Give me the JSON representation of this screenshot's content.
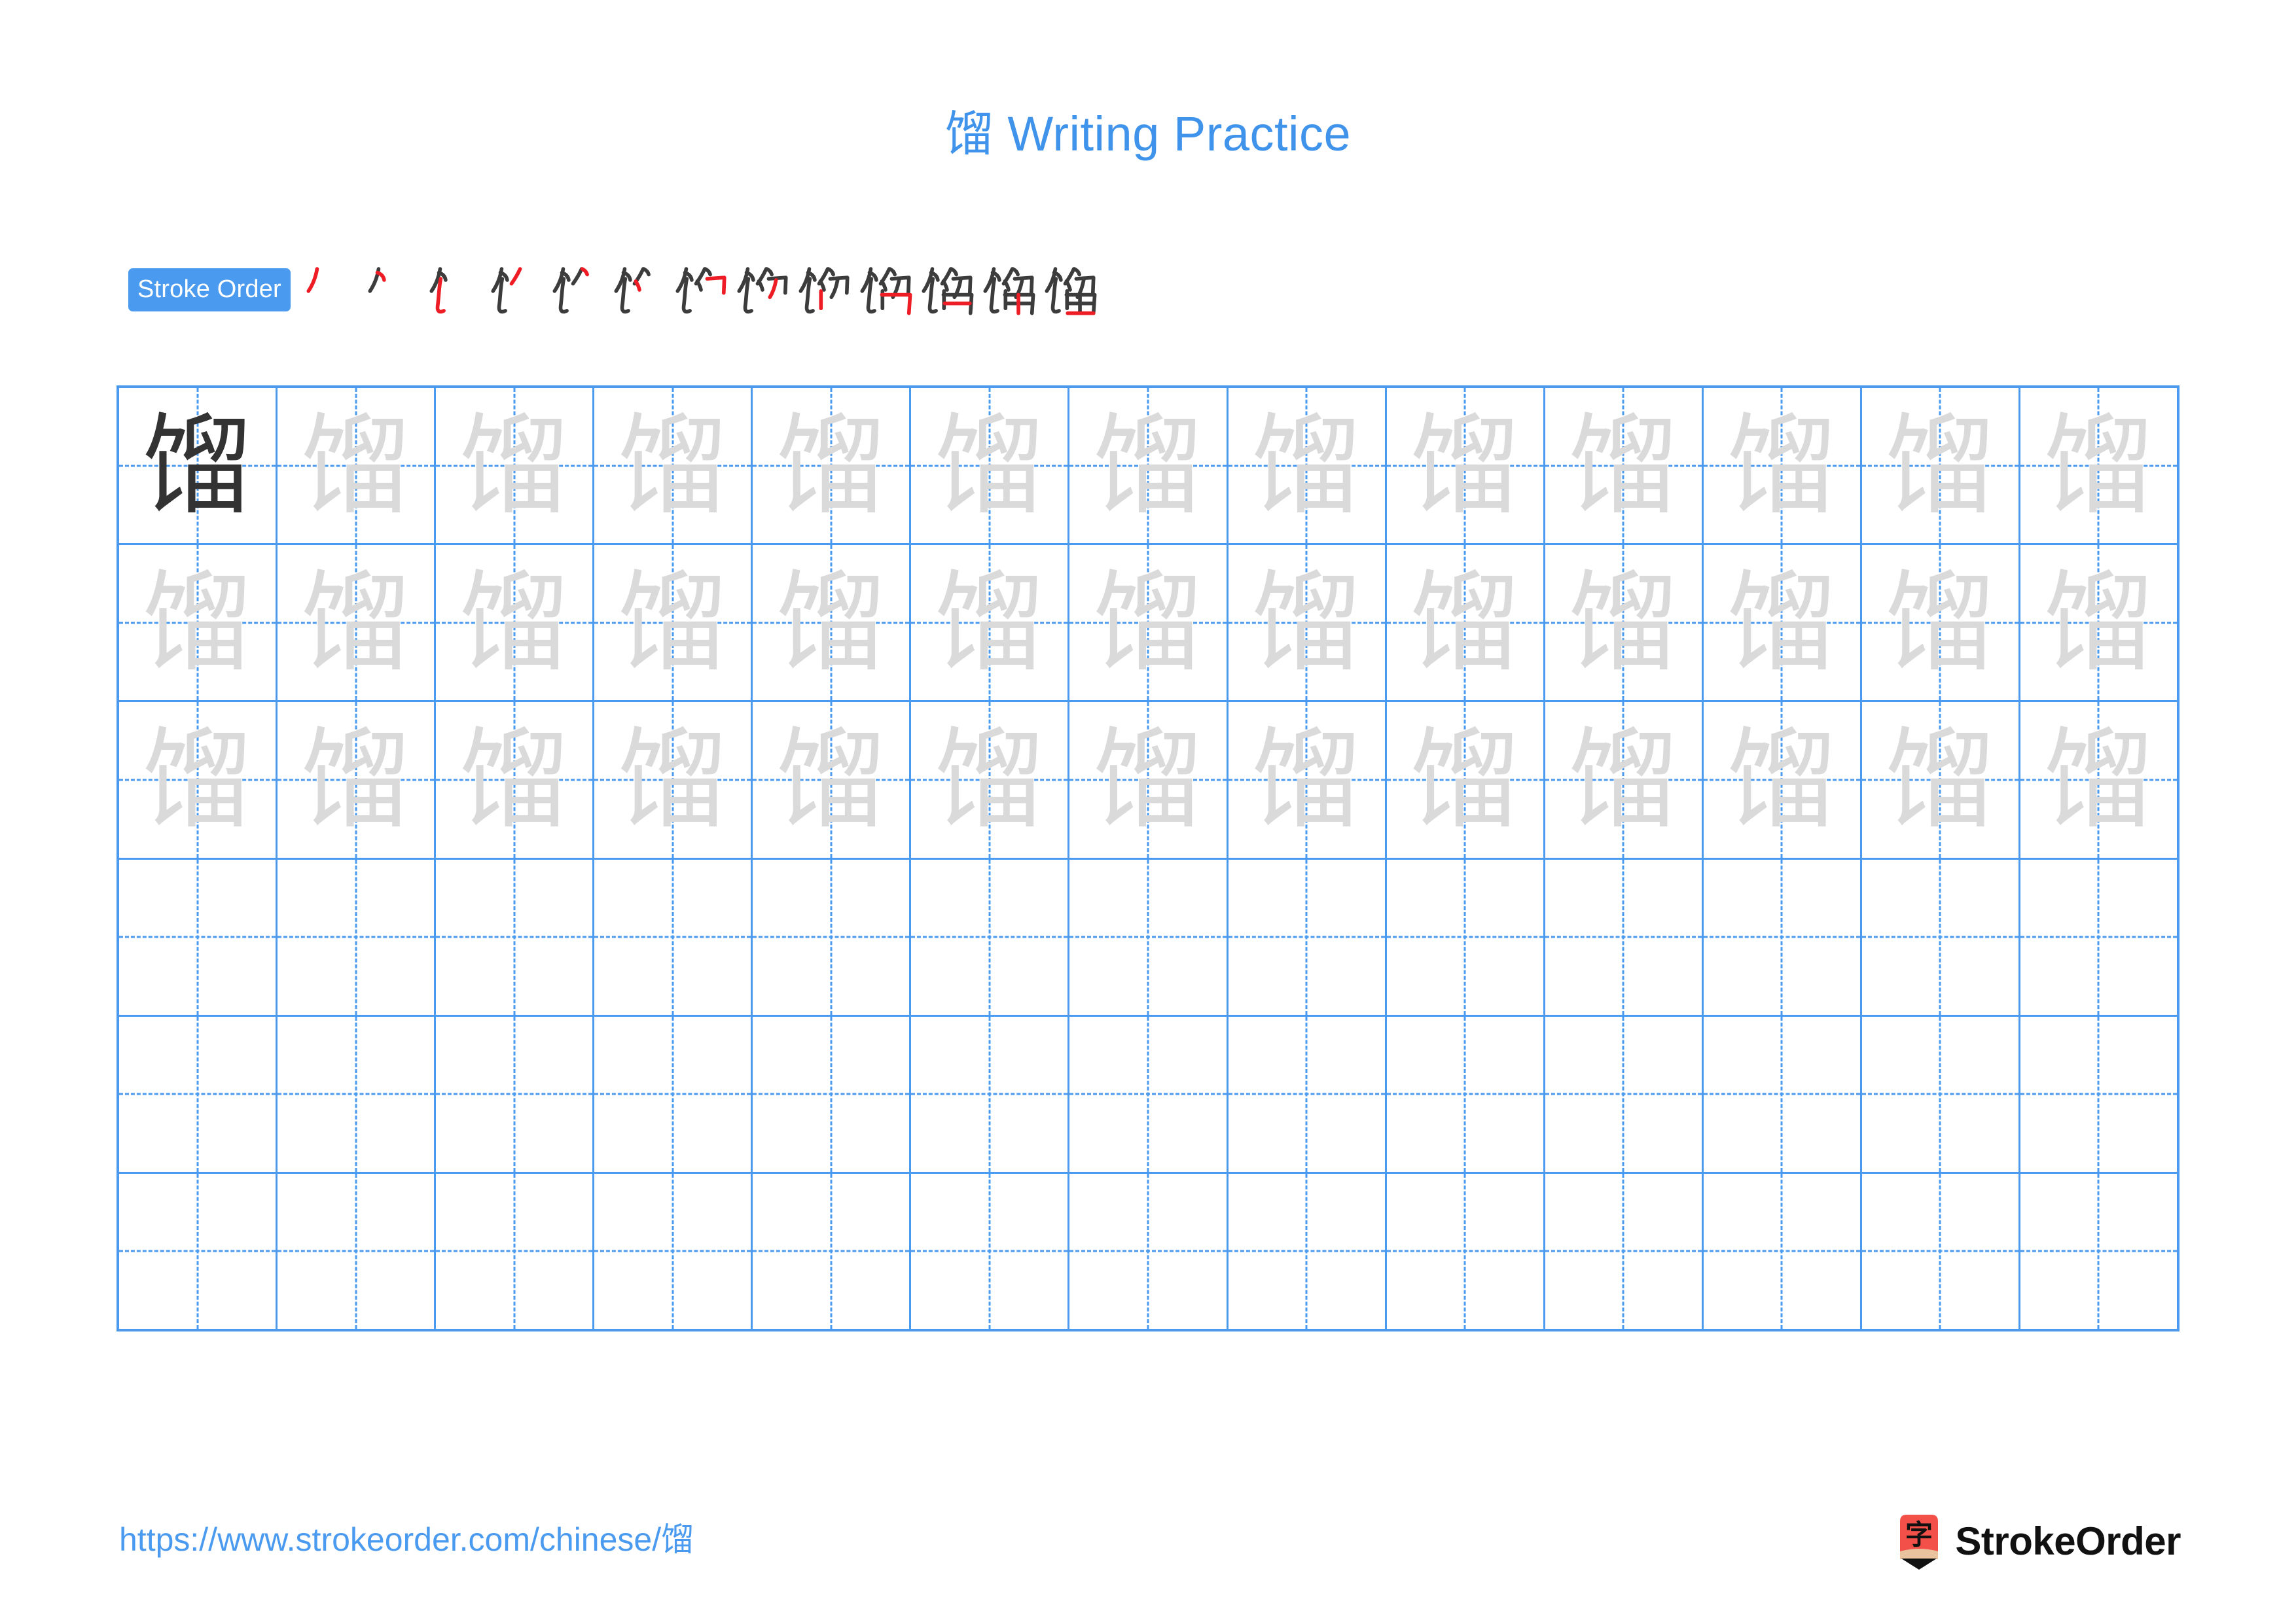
{
  "page": {
    "character": "馏",
    "title_suffix": " Writing Practice",
    "background_color": "#ffffff"
  },
  "colors": {
    "accent_blue": "#4a9bf0",
    "title_blue": "#3f93ea",
    "grid_line": "#4a9bf0",
    "trace_gray": "#dadada",
    "model_dark": "#333333",
    "stroke_new_red": "#ee1c25",
    "stroke_old_dark": "#3c3c3c",
    "logo_red": "#f4504a",
    "logo_tan": "#e8c39e"
  },
  "stroke_order": {
    "badge_label": "Stroke Order",
    "total_strokes": 13,
    "steps": [
      {
        "index": 1,
        "new_stroke": "丿",
        "cumulative": "丿"
      },
      {
        "index": 2,
        "new_stroke": "㇏",
        "cumulative": "𠂊"
      },
      {
        "index": 3,
        "new_stroke": "㇙",
        "cumulative": "饣"
      },
      {
        "index": 4,
        "new_stroke": "丿",
        "cumulative": "饣丿"
      },
      {
        "index": 5,
        "new_stroke": "㇀",
        "cumulative": "饣丿㇀"
      },
      {
        "index": 6,
        "new_stroke": "丶",
        "cumulative": "饣⺈"
      },
      {
        "index": 7,
        "new_stroke": "㇆",
        "cumulative": "饣⺈㇆"
      },
      {
        "index": 8,
        "new_stroke": "丿",
        "cumulative": "饣卯"
      },
      {
        "index": 9,
        "new_stroke": "丨",
        "cumulative": "饣卯丨"
      },
      {
        "index": 10,
        "new_stroke": "㇕",
        "cumulative": "馏(10)"
      },
      {
        "index": 11,
        "new_stroke": "一",
        "cumulative": "馏(11)"
      },
      {
        "index": 12,
        "new_stroke": "丨",
        "cumulative": "馏(12)"
      },
      {
        "index": 13,
        "new_stroke": "一",
        "cumulative": "馏"
      }
    ]
  },
  "practice_grid": {
    "columns": 13,
    "rows": 6,
    "cell_character": "馏",
    "row_types": [
      "model-first",
      "trace",
      "trace",
      "blank",
      "blank",
      "blank"
    ],
    "rows_data": [
      {
        "type": "model-first",
        "cells": [
          "馏",
          "馏",
          "馏",
          "馏",
          "馏",
          "馏",
          "馏",
          "馏",
          "馏",
          "馏",
          "馏",
          "馏",
          "馏"
        ],
        "shades": [
          "dark",
          "light",
          "light",
          "light",
          "light",
          "light",
          "light",
          "light",
          "light",
          "light",
          "light",
          "light",
          "light"
        ]
      },
      {
        "type": "trace",
        "cells": [
          "馏",
          "馏",
          "馏",
          "馏",
          "馏",
          "馏",
          "馏",
          "馏",
          "馏",
          "馏",
          "馏",
          "馏",
          "馏"
        ],
        "shades": [
          "light",
          "light",
          "light",
          "light",
          "light",
          "light",
          "light",
          "light",
          "light",
          "light",
          "light",
          "light",
          "light"
        ]
      },
      {
        "type": "trace",
        "cells": [
          "馏",
          "馏",
          "馏",
          "馏",
          "馏",
          "馏",
          "馏",
          "馏",
          "馏",
          "馏",
          "馏",
          "馏",
          "馏"
        ],
        "shades": [
          "light",
          "light",
          "light",
          "light",
          "light",
          "light",
          "light",
          "light",
          "light",
          "light",
          "light",
          "light",
          "light"
        ]
      },
      {
        "type": "blank",
        "cells": [
          "",
          "",
          "",
          "",
          "",
          "",
          "",
          "",
          "",
          "",
          "",
          "",
          ""
        ],
        "shades": [
          "",
          "",
          "",
          "",
          "",
          "",
          "",
          "",
          "",
          "",
          "",
          "",
          ""
        ]
      },
      {
        "type": "blank",
        "cells": [
          "",
          "",
          "",
          "",
          "",
          "",
          "",
          "",
          "",
          "",
          "",
          "",
          ""
        ],
        "shades": [
          "",
          "",
          "",
          "",
          "",
          "",
          "",
          "",
          "",
          "",
          "",
          "",
          ""
        ]
      },
      {
        "type": "blank",
        "cells": [
          "",
          "",
          "",
          "",
          "",
          "",
          "",
          "",
          "",
          "",
          "",
          "",
          ""
        ],
        "shades": [
          "",
          "",
          "",
          "",
          "",
          "",
          "",
          "",
          "",
          "",
          "",
          "",
          ""
        ]
      }
    ]
  },
  "footer": {
    "url_prefix": "https://www.strokeorder.com/chinese/",
    "url_character": "馏",
    "brand_name": "StrokeOrder",
    "brand_mark_character": "字"
  }
}
